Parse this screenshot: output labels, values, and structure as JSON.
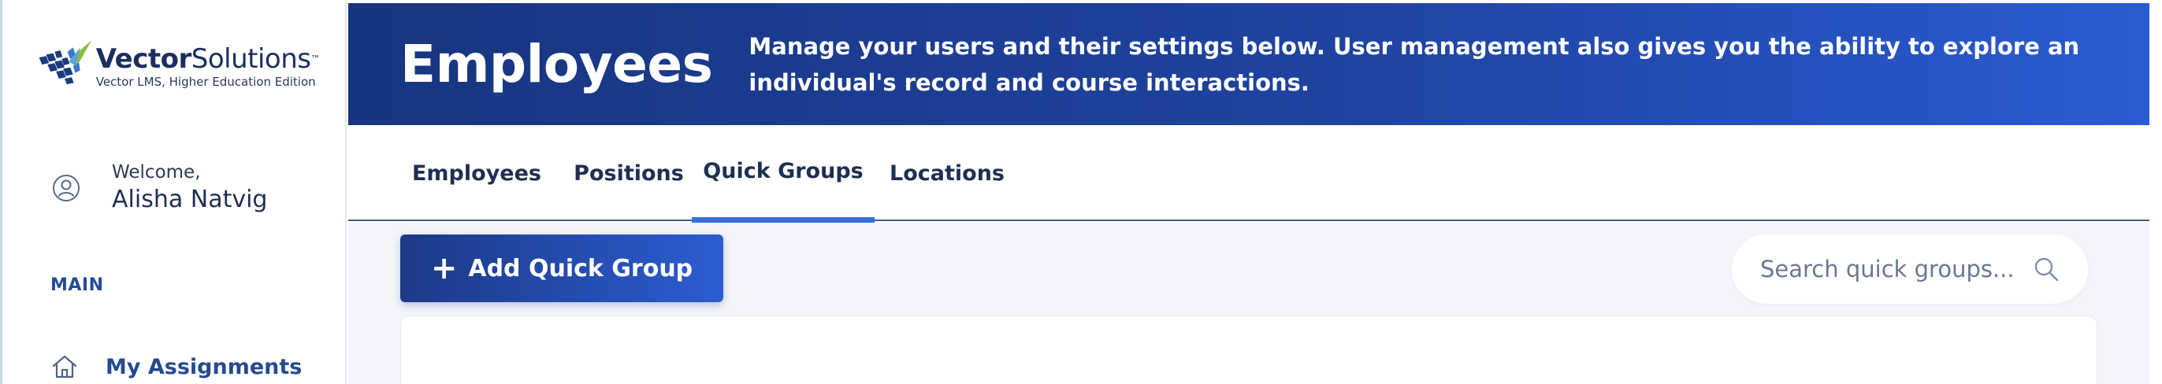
{
  "brand": {
    "name_bold": "Vector",
    "name_light": "Solutions",
    "trademark": "™",
    "subtitle": "Vector LMS, Higher Education Edition"
  },
  "user": {
    "welcome_label": "Welcome,",
    "name": "Alisha Natvig"
  },
  "sidebar": {
    "section_label": "MAIN",
    "items": [
      {
        "label": "My Assignments",
        "icon": "home-icon"
      }
    ]
  },
  "header": {
    "title": "Employees",
    "description": "Manage your users and their settings below. User management also gives you the ability to explore an individual's record and course interactions."
  },
  "tabs": [
    {
      "label": "Employees",
      "active": false
    },
    {
      "label": "Positions",
      "active": false
    },
    {
      "label": "Quick Groups",
      "active": true
    },
    {
      "label": "Locations",
      "active": false
    }
  ],
  "toolbar": {
    "add_label": "Add Quick Group",
    "add_icon": "plus-icon",
    "search_placeholder": "Search quick groups...",
    "search_icon": "search-icon"
  },
  "colors": {
    "banner_start": "#17357f",
    "banner_end": "#2a5bd0",
    "accent": "#3b6fd6",
    "nav_text": "#274a8e",
    "content_bg": "#f3f5f9"
  }
}
